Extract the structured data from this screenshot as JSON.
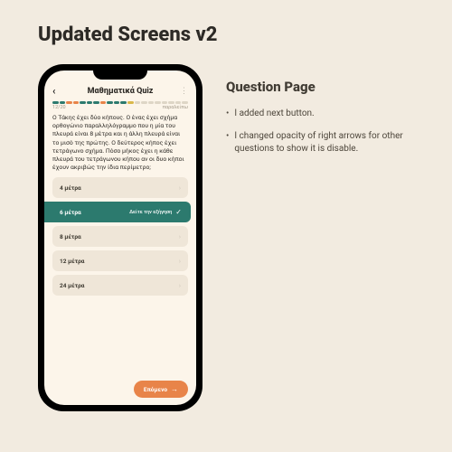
{
  "page": {
    "title": "Updated Screens v2"
  },
  "section": {
    "title": "Question Page",
    "bullets": [
      "I added next button.",
      "I changed opacity of right arrows for other questions to show it is disable."
    ]
  },
  "phone": {
    "header": {
      "title": "Μαθηματικά Quiz"
    },
    "meta": {
      "counter": "12/20",
      "skip": "παραλείπω"
    },
    "question": "Ο Τάκης έχει δύο κήπους. Ο ένας έχει σχήμα ορθογώνιο παραλληλόγραμμο που η μία του πλευρά είναι 8 μέτρα και η άλλη πλευρά είναι το μισό της πρώτης. Ο δεύτερος κήπος έχει τετράγωνο σχήμα. Πόσο μήκος έχει η κάθε πλευρά του τετράγωνου κήπου αν οι δυο κήποι έχουν ακριβώς την ίδια περίμετρο;",
    "answers": [
      {
        "label": "4 μέτρα",
        "correct": false
      },
      {
        "label": "6 μέτρα",
        "correct": true,
        "explain": "Δείτε την εξήγηση"
      },
      {
        "label": "8 μέτρα",
        "correct": false
      },
      {
        "label": "12 μέτρα",
        "correct": false
      },
      {
        "label": "24 μέτρα",
        "correct": false
      }
    ],
    "next": "Επόμενο",
    "progress": {
      "total": 20,
      "colors": [
        "#2c7a6e",
        "#2c7a6e",
        "#e88449",
        "#e88449",
        "#2c7a6e",
        "#2c7a6e",
        "#2c7a6e",
        "#e88449",
        "#2c7a6e",
        "#2c7a6e",
        "#2c7a6e",
        "#d9b84a",
        "#ded6c6",
        "#ded6c6",
        "#ded6c6",
        "#ded6c6",
        "#ded6c6",
        "#ded6c6",
        "#ded6c6",
        "#ded6c6"
      ]
    }
  },
  "colors": {
    "accent_teal": "#2c7a6e",
    "accent_orange": "#e88449",
    "answer_bg": "#efe6d8",
    "page_bg": "#f2ebe0",
    "screen_bg": "#fcf5ea"
  }
}
